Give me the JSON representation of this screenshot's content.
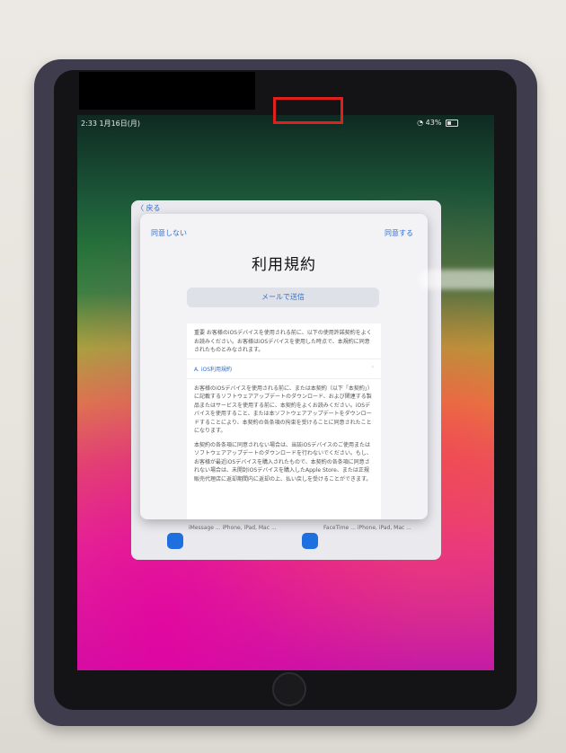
{
  "status_bar": {
    "time": "2:33 1月16日(月)",
    "battery": "43%"
  },
  "back_sheet": {
    "back_label": "〈 戻る",
    "items": [
      {
        "text": "iMessage ... iPhone, iPad, Mac ...",
        "icon": "message-icon",
        "color": "#1e6fe0"
      },
      {
        "text": "FaceTime ... iPhone, iPad, Mac ...",
        "icon": "video-camera-icon",
        "color": "#1e6fe0"
      }
    ]
  },
  "modal": {
    "disagree_label": "同意しない",
    "agree_label": "同意する",
    "title": "利用規約",
    "email_button_label": "メールで送信",
    "doc_intro": "重要\nお客様のiOSデバイスを使用される前に、以下の使用許諾契約をよくお読みください。お客様はiOSデバイスを使用した時点で、本規約に同意されたものとみなされます。",
    "doc_section_title": "A. iOS利用規約",
    "doc_paragraph1": "お客様のiOSデバイスを使用される前に、または本契約（以下「本契約」）に記載するソフトウェアアップデートのダウンロード、および関連する製品またはサービスを使用する前に、本契約をよくお読みください。iOSデバイスを使用すること、または本ソフトウェアアップデートをダウンロードすることにより、本契約の各条項の拘束を受けることに同意されたことになります。",
    "doc_paragraph2": "本契約の各条項に同意されない場合は、当該iOSデバイスのご使用またはソフトウェアアップデートのダウンロードを行わないでください。もし、お客様が最近iOSデバイスを購入されたもので、本契約の各条項に同意されない場合は、未開封iOSデバイスを購入したApple Store、または正規販売代理店に返却期間内に返却の上、払い戻しを受けることができます。"
  },
  "annotation": {
    "highlight_color": "#e0201d"
  }
}
